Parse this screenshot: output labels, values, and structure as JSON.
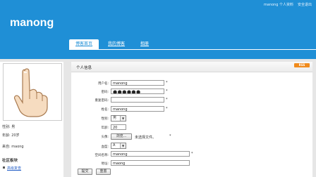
{
  "header": {
    "site_title": "manong",
    "top_links": {
      "user": "manong 个人资料",
      "logout": "安全退出"
    },
    "nav": [
      "博客首页",
      "我的博客",
      "相册"
    ]
  },
  "sidebar": {
    "gender": "性别: 男",
    "age": "年龄: 20岁",
    "from": "来自: maong",
    "section_title": "社区板块",
    "links": [
      "高级复查"
    ]
  },
  "panel": {
    "title": "个人信息",
    "rss": "RSS"
  },
  "form": {
    "username_label": "用户名:",
    "username_value": "manong",
    "password_label": "密码:",
    "password_value": "●●●●●●",
    "repassword_label": "重复密码:",
    "repassword_value": "",
    "name_label": "姓名:",
    "name_value": "manong",
    "gender_label": "性别:",
    "gender_value": "男",
    "age_label": "年龄:",
    "age_value": "20",
    "avatar_label": "头像:",
    "browse_label": "浏览...",
    "file_status": "未选择文件。",
    "blood_label": "血型:",
    "blood_value": "A",
    "space_label": "空间名称:",
    "space_value": "manong",
    "addr_label": "地址:",
    "addr_value": "maong",
    "star": "*",
    "submit": "提交",
    "reset": "重置"
  }
}
